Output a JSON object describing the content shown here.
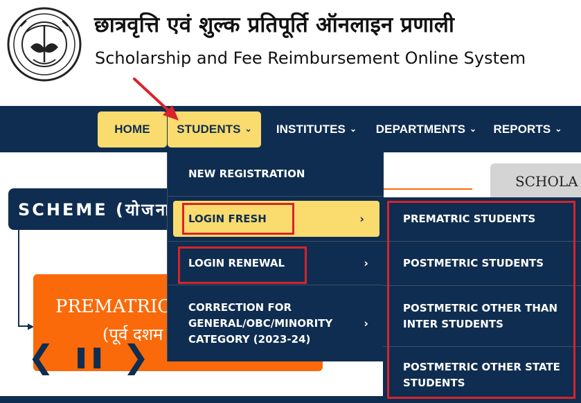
{
  "header": {
    "title_hindi": "छात्रवृत्ति एवं शुल्क प्रतिपूर्ति ऑनलाइन प्रणाली",
    "title_english": "Scholarship and Fee Reimbursement Online System",
    "emblem_icon": "up-government-seal"
  },
  "nav": {
    "items": [
      {
        "label": "HOME"
      },
      {
        "label": "STUDENTS"
      },
      {
        "label": "INSTITUTES"
      },
      {
        "label": "DEPARTMENTS"
      },
      {
        "label": "REPORTS"
      }
    ],
    "chevron": "⌄"
  },
  "students_menu": {
    "items": [
      {
        "label": "NEW REGISTRATION"
      },
      {
        "label": "LOGIN FRESH",
        "arrow": "›"
      },
      {
        "label": "LOGIN RENEWAL",
        "arrow": "›"
      },
      {
        "label": "CORRECTION FOR GENERAL/OBC/MINORITY CATEGORY (2023-24)",
        "arrow": "›"
      }
    ]
  },
  "login_fresh_submenu": {
    "items": [
      {
        "label": "PREMATRIC STUDENTS"
      },
      {
        "label": "POSTMETRIC STUDENTS"
      },
      {
        "label": "POSTMETRIC OTHER THAN INTER STUDENTS"
      },
      {
        "label": "POSTMETRIC OTHER STATE STUDENTS"
      }
    ]
  },
  "content": {
    "scheme_label": "SCHEME (योजना)",
    "card_title": "PREMATRIC",
    "card_subtitle": "(पूर्व दशम",
    "right_box": "SCHOLA"
  },
  "carousel": {
    "prev": "❮",
    "pause": "❚❚",
    "next": "❯"
  },
  "colors": {
    "navy": "#0f2d50",
    "yellow": "#fadb6e",
    "orange": "#fa6a0a",
    "annotation_red": "#d8232a"
  }
}
